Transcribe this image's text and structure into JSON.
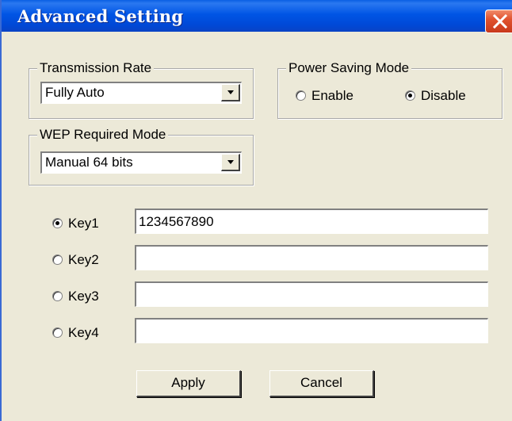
{
  "window": {
    "title": "Advanced Setting"
  },
  "transmission_rate": {
    "legend": "Transmission Rate",
    "selected": "Fully Auto"
  },
  "power_saving": {
    "legend": "Power Saving Mode",
    "options": [
      "Enable",
      "Disable"
    ],
    "selected": "Disable"
  },
  "wep": {
    "legend": "WEP Required Mode",
    "selected": "Manual 64 bits"
  },
  "keys": [
    {
      "label": "Key1",
      "value": "1234567890",
      "selected": true
    },
    {
      "label": "Key2",
      "value": "",
      "selected": false
    },
    {
      "label": "Key3",
      "value": "",
      "selected": false
    },
    {
      "label": "Key4",
      "value": "",
      "selected": false
    }
  ],
  "buttons": {
    "apply": "Apply",
    "cancel": "Cancel"
  }
}
